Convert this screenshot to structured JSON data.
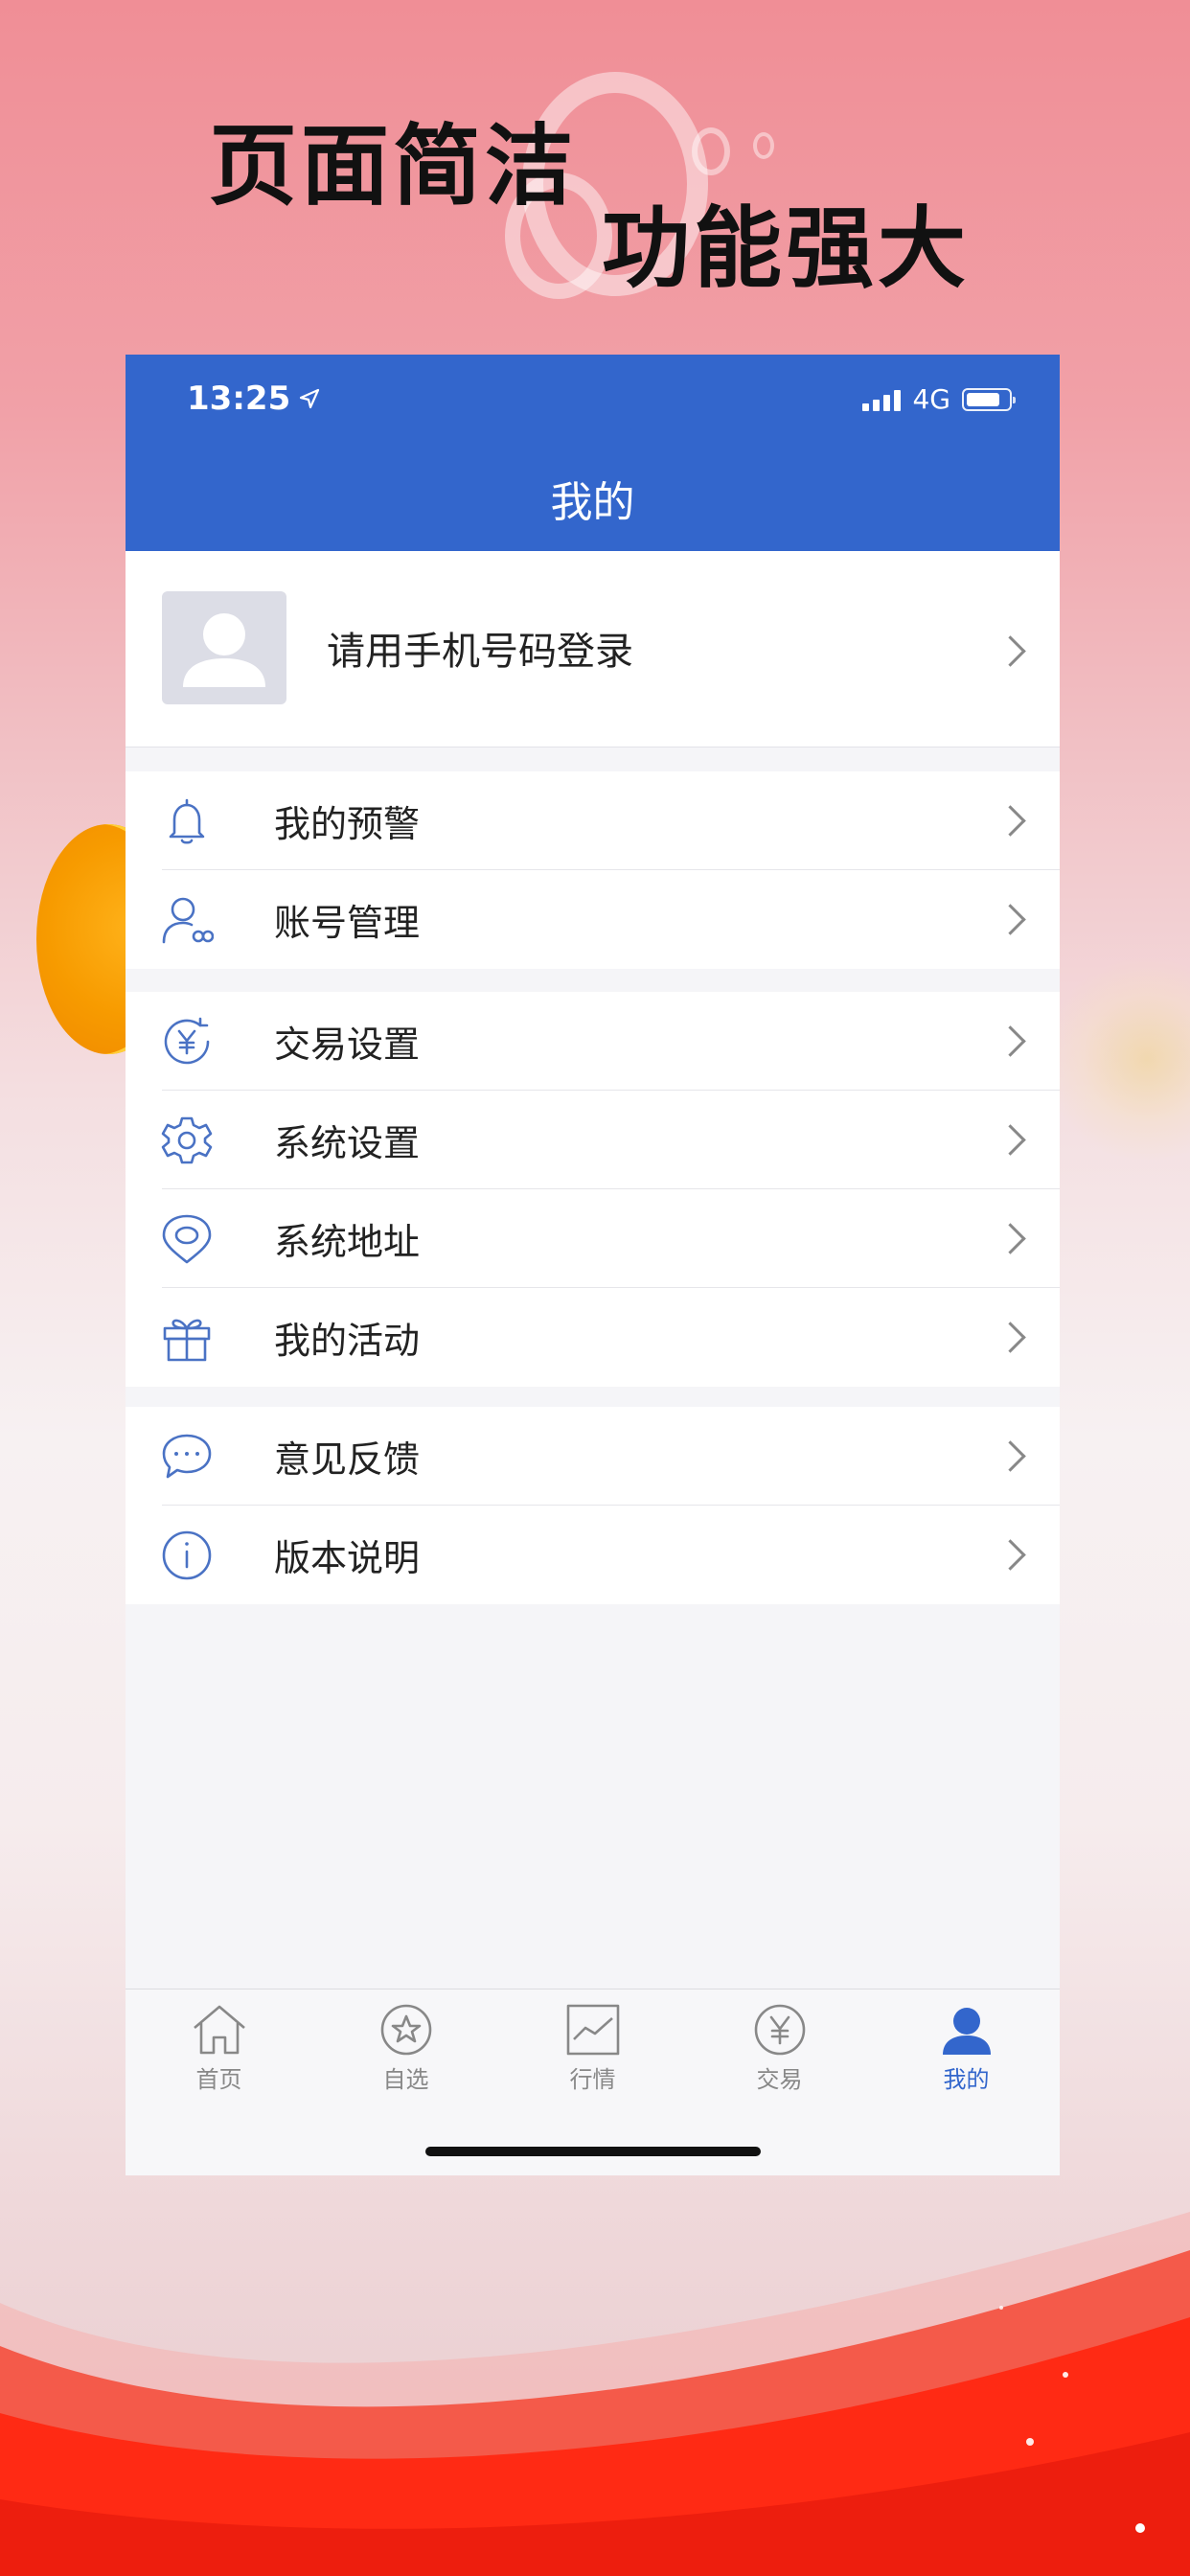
{
  "promo": {
    "headline_left": "页面简洁",
    "headline_right": "功能强大"
  },
  "status_bar": {
    "time": "13:25",
    "network": "4G",
    "location_icon": "location-arrow-icon",
    "signal_icon": "signal-bars-icon",
    "battery_icon": "battery-icon"
  },
  "nav": {
    "title": "我的"
  },
  "login": {
    "prompt": "请用手机号码登录",
    "avatar_icon": "default-avatar-icon"
  },
  "menu_groups": [
    {
      "items": [
        {
          "label": "我的预警",
          "icon": "bell-icon"
        },
        {
          "label": "账号管理",
          "icon": "user-account-icon"
        }
      ]
    },
    {
      "items": [
        {
          "label": "交易设置",
          "icon": "yen-cycle-icon"
        },
        {
          "label": "系统设置",
          "icon": "gear-icon"
        },
        {
          "label": "系统地址",
          "icon": "location-pin-icon"
        },
        {
          "label": "我的活动",
          "icon": "gift-icon"
        }
      ]
    },
    {
      "items": [
        {
          "label": "意见反馈",
          "icon": "chat-bubble-icon"
        },
        {
          "label": "版本说明",
          "icon": "info-icon"
        }
      ]
    }
  ],
  "tab_bar": {
    "active_index": 4,
    "tabs": [
      {
        "label": "首页",
        "icon": "home-icon"
      },
      {
        "label": "自选",
        "icon": "star-circle-icon"
      },
      {
        "label": "行情",
        "icon": "line-chart-icon"
      },
      {
        "label": "交易",
        "icon": "yen-circle-icon"
      },
      {
        "label": "我的",
        "icon": "person-icon"
      }
    ]
  },
  "colors": {
    "primary": "#3366cc",
    "icon_blue": "#4a72c4",
    "background_pink": "#f08e96",
    "wave_red": "#ff2a14"
  }
}
